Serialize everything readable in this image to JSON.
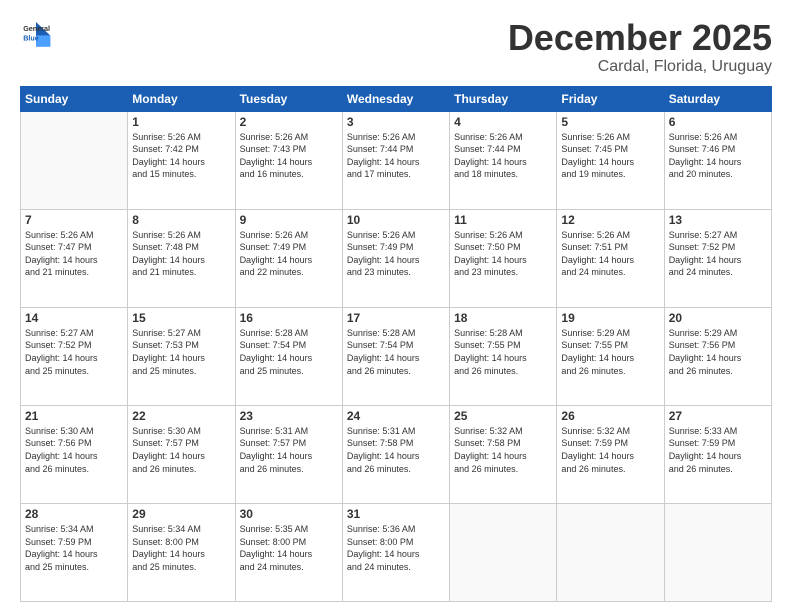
{
  "logo": {
    "line1": "General",
    "line2": "Blue"
  },
  "header": {
    "month": "December 2025",
    "location": "Cardal, Florida, Uruguay"
  },
  "weekdays": [
    "Sunday",
    "Monday",
    "Tuesday",
    "Wednesday",
    "Thursday",
    "Friday",
    "Saturday"
  ],
  "weeks": [
    [
      {
        "day": "",
        "info": ""
      },
      {
        "day": "1",
        "info": "Sunrise: 5:26 AM\nSunset: 7:42 PM\nDaylight: 14 hours\nand 15 minutes."
      },
      {
        "day": "2",
        "info": "Sunrise: 5:26 AM\nSunset: 7:43 PM\nDaylight: 14 hours\nand 16 minutes."
      },
      {
        "day": "3",
        "info": "Sunrise: 5:26 AM\nSunset: 7:44 PM\nDaylight: 14 hours\nand 17 minutes."
      },
      {
        "day": "4",
        "info": "Sunrise: 5:26 AM\nSunset: 7:44 PM\nDaylight: 14 hours\nand 18 minutes."
      },
      {
        "day": "5",
        "info": "Sunrise: 5:26 AM\nSunset: 7:45 PM\nDaylight: 14 hours\nand 19 minutes."
      },
      {
        "day": "6",
        "info": "Sunrise: 5:26 AM\nSunset: 7:46 PM\nDaylight: 14 hours\nand 20 minutes."
      }
    ],
    [
      {
        "day": "7",
        "info": "Sunrise: 5:26 AM\nSunset: 7:47 PM\nDaylight: 14 hours\nand 21 minutes."
      },
      {
        "day": "8",
        "info": "Sunrise: 5:26 AM\nSunset: 7:48 PM\nDaylight: 14 hours\nand 21 minutes."
      },
      {
        "day": "9",
        "info": "Sunrise: 5:26 AM\nSunset: 7:49 PM\nDaylight: 14 hours\nand 22 minutes."
      },
      {
        "day": "10",
        "info": "Sunrise: 5:26 AM\nSunset: 7:49 PM\nDaylight: 14 hours\nand 23 minutes."
      },
      {
        "day": "11",
        "info": "Sunrise: 5:26 AM\nSunset: 7:50 PM\nDaylight: 14 hours\nand 23 minutes."
      },
      {
        "day": "12",
        "info": "Sunrise: 5:26 AM\nSunset: 7:51 PM\nDaylight: 14 hours\nand 24 minutes."
      },
      {
        "day": "13",
        "info": "Sunrise: 5:27 AM\nSunset: 7:52 PM\nDaylight: 14 hours\nand 24 minutes."
      }
    ],
    [
      {
        "day": "14",
        "info": "Sunrise: 5:27 AM\nSunset: 7:52 PM\nDaylight: 14 hours\nand 25 minutes."
      },
      {
        "day": "15",
        "info": "Sunrise: 5:27 AM\nSunset: 7:53 PM\nDaylight: 14 hours\nand 25 minutes."
      },
      {
        "day": "16",
        "info": "Sunrise: 5:28 AM\nSunset: 7:54 PM\nDaylight: 14 hours\nand 25 minutes."
      },
      {
        "day": "17",
        "info": "Sunrise: 5:28 AM\nSunset: 7:54 PM\nDaylight: 14 hours\nand 26 minutes."
      },
      {
        "day": "18",
        "info": "Sunrise: 5:28 AM\nSunset: 7:55 PM\nDaylight: 14 hours\nand 26 minutes."
      },
      {
        "day": "19",
        "info": "Sunrise: 5:29 AM\nSunset: 7:55 PM\nDaylight: 14 hours\nand 26 minutes."
      },
      {
        "day": "20",
        "info": "Sunrise: 5:29 AM\nSunset: 7:56 PM\nDaylight: 14 hours\nand 26 minutes."
      }
    ],
    [
      {
        "day": "21",
        "info": "Sunrise: 5:30 AM\nSunset: 7:56 PM\nDaylight: 14 hours\nand 26 minutes."
      },
      {
        "day": "22",
        "info": "Sunrise: 5:30 AM\nSunset: 7:57 PM\nDaylight: 14 hours\nand 26 minutes."
      },
      {
        "day": "23",
        "info": "Sunrise: 5:31 AM\nSunset: 7:57 PM\nDaylight: 14 hours\nand 26 minutes."
      },
      {
        "day": "24",
        "info": "Sunrise: 5:31 AM\nSunset: 7:58 PM\nDaylight: 14 hours\nand 26 minutes."
      },
      {
        "day": "25",
        "info": "Sunrise: 5:32 AM\nSunset: 7:58 PM\nDaylight: 14 hours\nand 26 minutes."
      },
      {
        "day": "26",
        "info": "Sunrise: 5:32 AM\nSunset: 7:59 PM\nDaylight: 14 hours\nand 26 minutes."
      },
      {
        "day": "27",
        "info": "Sunrise: 5:33 AM\nSunset: 7:59 PM\nDaylight: 14 hours\nand 26 minutes."
      }
    ],
    [
      {
        "day": "28",
        "info": "Sunrise: 5:34 AM\nSunset: 7:59 PM\nDaylight: 14 hours\nand 25 minutes."
      },
      {
        "day": "29",
        "info": "Sunrise: 5:34 AM\nSunset: 8:00 PM\nDaylight: 14 hours\nand 25 minutes."
      },
      {
        "day": "30",
        "info": "Sunrise: 5:35 AM\nSunset: 8:00 PM\nDaylight: 14 hours\nand 24 minutes."
      },
      {
        "day": "31",
        "info": "Sunrise: 5:36 AM\nSunset: 8:00 PM\nDaylight: 14 hours\nand 24 minutes."
      },
      {
        "day": "",
        "info": ""
      },
      {
        "day": "",
        "info": ""
      },
      {
        "day": "",
        "info": ""
      }
    ]
  ]
}
